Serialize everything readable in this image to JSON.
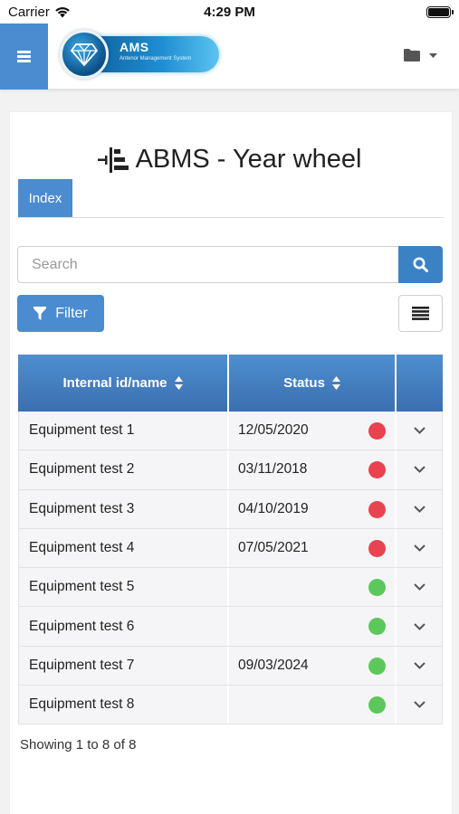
{
  "status_bar": {
    "carrier": "Carrier",
    "time": "4:29 PM"
  },
  "logo": {
    "title": "AMS",
    "subtitle": "Antenor Management System"
  },
  "page": {
    "title": "ABMS - Year wheel"
  },
  "tabs": [
    {
      "label": "Index"
    }
  ],
  "search": {
    "placeholder": "Search"
  },
  "filter": {
    "label": "Filter"
  },
  "table": {
    "columns": [
      {
        "label": "Internal id/name"
      },
      {
        "label": "Status"
      },
      {
        "label": ""
      }
    ],
    "rows": [
      {
        "name": "Equipment test 1",
        "date": "12/05/2020",
        "status": "red"
      },
      {
        "name": "Equipment test 2",
        "date": "03/11/2018",
        "status": "red"
      },
      {
        "name": "Equipment test 3",
        "date": "04/10/2019",
        "status": "red"
      },
      {
        "name": "Equipment test 4",
        "date": "07/05/2021",
        "status": "red"
      },
      {
        "name": "Equipment test 5",
        "date": "",
        "status": "green"
      },
      {
        "name": "Equipment test 6",
        "date": "",
        "status": "green"
      },
      {
        "name": "Equipment test 7",
        "date": "09/03/2024",
        "status": "green"
      },
      {
        "name": "Equipment test 8",
        "date": "",
        "status": "green"
      }
    ]
  },
  "footer": {
    "showing": "Showing 1 to 8 of 8"
  },
  "colors": {
    "primary": "#4a8ccf",
    "status_red": "#e8434f",
    "status_green": "#5cc85c"
  },
  "icons": [
    "wifi-icon",
    "battery-icon",
    "hamburger-icon",
    "folder-icon",
    "caret-down-icon",
    "year-wheel-icon",
    "search-icon",
    "filter-icon",
    "list-icon",
    "sort-icon",
    "chevron-down-icon"
  ]
}
